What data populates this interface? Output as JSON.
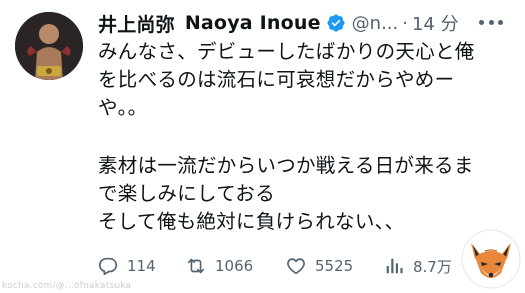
{
  "tweet": {
    "author": {
      "name_jp": "井上尚弥",
      "name_en": "Naoya Inoue",
      "handle": "@n...",
      "verified": true
    },
    "time": "14 分",
    "separator": "·",
    "text_lines": [
      "みんなさ、デビューしたばかりの天心と俺",
      "を比べるのは流石に可哀想だからやめー",
      "や。。",
      "",
      "素材は一流だからいつか戦える日が来るま",
      "で楽しみにしておる",
      "そして俺も絶対に負けられない、、"
    ],
    "stats": {
      "replies": "114",
      "retweets": "1066",
      "likes": "5525",
      "views": "8.7万"
    },
    "icons": [
      "verified-badge-icon",
      "more-icon",
      "reply-icon",
      "retweet-icon",
      "like-icon",
      "views-icon"
    ],
    "colors": {
      "text": "#0f1419",
      "muted": "#536471",
      "verified": "#1d9bf0"
    }
  },
  "overlay": {
    "watermark_text": "kocha.com/@...ofnakatsuka",
    "fox_logo": "fox-logo"
  }
}
